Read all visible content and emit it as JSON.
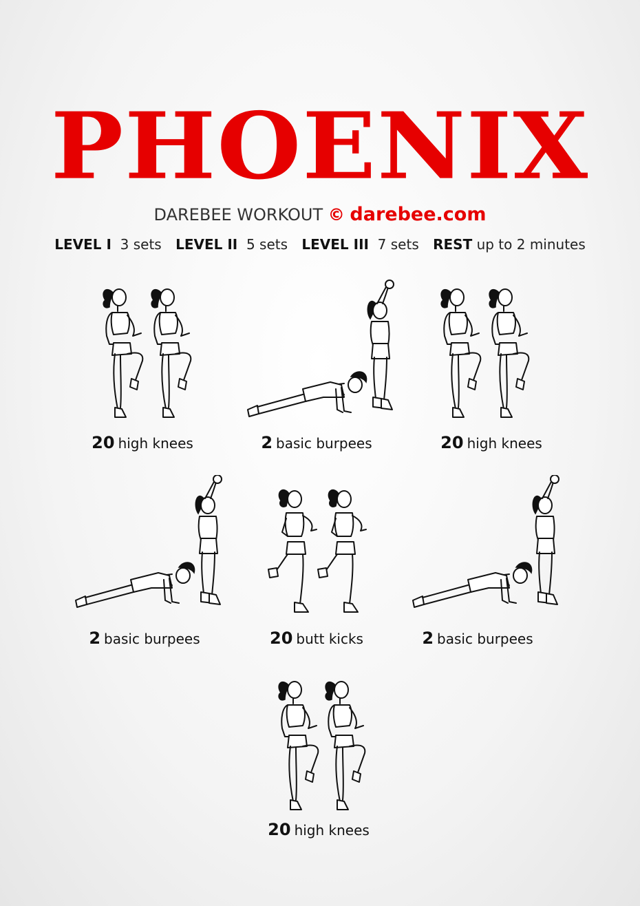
{
  "title": "PHOENIX",
  "subtitle": {
    "prefix": "DAREBEE WORKOUT",
    "copyright_symbol": "©",
    "site": "darebee.com"
  },
  "levels": [
    {
      "label": "LEVEL I",
      "value": "3 sets"
    },
    {
      "label": "LEVEL II",
      "value": "5 sets"
    },
    {
      "label": "LEVEL III",
      "value": "7 sets"
    },
    {
      "label": "REST",
      "value": "up to 2 minutes"
    }
  ],
  "exercises": [
    {
      "count": "20",
      "name": "high knees",
      "figure": "high-knees-figure"
    },
    {
      "count": "2",
      "name": "basic burpees",
      "figure": "burpee-figure"
    },
    {
      "count": "20",
      "name": "high knees",
      "figure": "high-knees-figure"
    },
    {
      "count": "2",
      "name": "basic burpees",
      "figure": "burpee-figure"
    },
    {
      "count": "20",
      "name": "butt kicks",
      "figure": "butt-kicks-figure"
    },
    {
      "count": "2",
      "name": "basic burpees",
      "figure": "burpee-figure"
    },
    {
      "count": "20",
      "name": "high knees",
      "figure": "high-knees-figure"
    }
  ],
  "colors": {
    "accent": "#e60000",
    "text": "#111111",
    "background": "#f4f4f4"
  }
}
